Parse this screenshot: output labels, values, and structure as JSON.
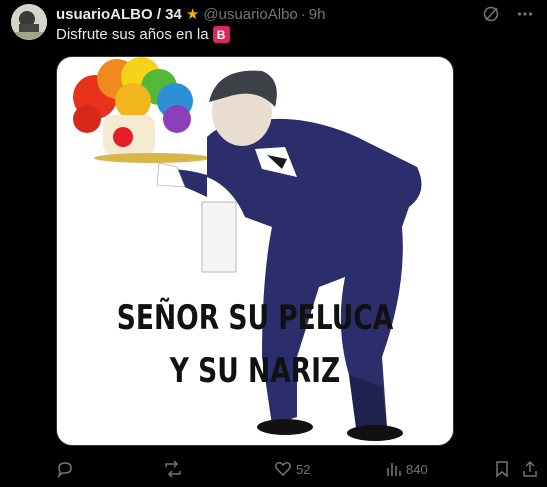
{
  "post": {
    "author_name": "usuarioALBO / 34",
    "star_icon": "star-icon",
    "handle": "@usuarioAlbo",
    "separator": "·",
    "time": "9h",
    "text": "Disfrute sus años en la",
    "badge_letter": "B",
    "badge_color": "#e0245e"
  },
  "media": {
    "caption_line1": "SEÑOR SU PELUCA",
    "caption_line2": "Y SU NARIZ"
  },
  "actions": {
    "reply_count": "",
    "repost_count": "",
    "like_count": "52",
    "views_count": "840"
  },
  "icons": [
    "grok-icon",
    "more-icon",
    "reply-icon",
    "repost-icon",
    "like-icon",
    "views-icon",
    "bookmark-icon",
    "share-icon"
  ]
}
